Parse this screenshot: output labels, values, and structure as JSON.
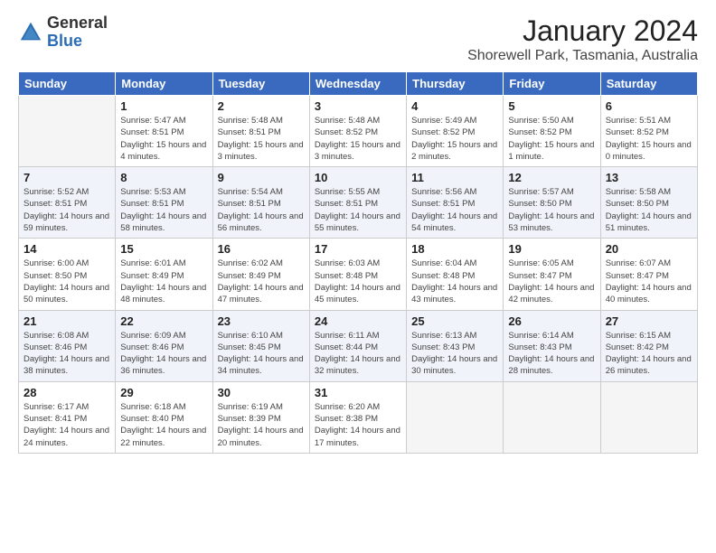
{
  "header": {
    "logo_general": "General",
    "logo_blue": "Blue",
    "title": "January 2024",
    "subtitle": "Shorewell Park, Tasmania, Australia"
  },
  "days_of_week": [
    "Sunday",
    "Monday",
    "Tuesday",
    "Wednesday",
    "Thursday",
    "Friday",
    "Saturday"
  ],
  "weeks": [
    [
      {
        "day": "",
        "sunrise": "",
        "sunset": "",
        "daylight": ""
      },
      {
        "day": "1",
        "sunrise": "Sunrise: 5:47 AM",
        "sunset": "Sunset: 8:51 PM",
        "daylight": "Daylight: 15 hours and 4 minutes."
      },
      {
        "day": "2",
        "sunrise": "Sunrise: 5:48 AM",
        "sunset": "Sunset: 8:51 PM",
        "daylight": "Daylight: 15 hours and 3 minutes."
      },
      {
        "day": "3",
        "sunrise": "Sunrise: 5:48 AM",
        "sunset": "Sunset: 8:52 PM",
        "daylight": "Daylight: 15 hours and 3 minutes."
      },
      {
        "day": "4",
        "sunrise": "Sunrise: 5:49 AM",
        "sunset": "Sunset: 8:52 PM",
        "daylight": "Daylight: 15 hours and 2 minutes."
      },
      {
        "day": "5",
        "sunrise": "Sunrise: 5:50 AM",
        "sunset": "Sunset: 8:52 PM",
        "daylight": "Daylight: 15 hours and 1 minute."
      },
      {
        "day": "6",
        "sunrise": "Sunrise: 5:51 AM",
        "sunset": "Sunset: 8:52 PM",
        "daylight": "Daylight: 15 hours and 0 minutes."
      }
    ],
    [
      {
        "day": "7",
        "sunrise": "Sunrise: 5:52 AM",
        "sunset": "Sunset: 8:51 PM",
        "daylight": "Daylight: 14 hours and 59 minutes."
      },
      {
        "day": "8",
        "sunrise": "Sunrise: 5:53 AM",
        "sunset": "Sunset: 8:51 PM",
        "daylight": "Daylight: 14 hours and 58 minutes."
      },
      {
        "day": "9",
        "sunrise": "Sunrise: 5:54 AM",
        "sunset": "Sunset: 8:51 PM",
        "daylight": "Daylight: 14 hours and 56 minutes."
      },
      {
        "day": "10",
        "sunrise": "Sunrise: 5:55 AM",
        "sunset": "Sunset: 8:51 PM",
        "daylight": "Daylight: 14 hours and 55 minutes."
      },
      {
        "day": "11",
        "sunrise": "Sunrise: 5:56 AM",
        "sunset": "Sunset: 8:51 PM",
        "daylight": "Daylight: 14 hours and 54 minutes."
      },
      {
        "day": "12",
        "sunrise": "Sunrise: 5:57 AM",
        "sunset": "Sunset: 8:50 PM",
        "daylight": "Daylight: 14 hours and 53 minutes."
      },
      {
        "day": "13",
        "sunrise": "Sunrise: 5:58 AM",
        "sunset": "Sunset: 8:50 PM",
        "daylight": "Daylight: 14 hours and 51 minutes."
      }
    ],
    [
      {
        "day": "14",
        "sunrise": "Sunrise: 6:00 AM",
        "sunset": "Sunset: 8:50 PM",
        "daylight": "Daylight: 14 hours and 50 minutes."
      },
      {
        "day": "15",
        "sunrise": "Sunrise: 6:01 AM",
        "sunset": "Sunset: 8:49 PM",
        "daylight": "Daylight: 14 hours and 48 minutes."
      },
      {
        "day": "16",
        "sunrise": "Sunrise: 6:02 AM",
        "sunset": "Sunset: 8:49 PM",
        "daylight": "Daylight: 14 hours and 47 minutes."
      },
      {
        "day": "17",
        "sunrise": "Sunrise: 6:03 AM",
        "sunset": "Sunset: 8:48 PM",
        "daylight": "Daylight: 14 hours and 45 minutes."
      },
      {
        "day": "18",
        "sunrise": "Sunrise: 6:04 AM",
        "sunset": "Sunset: 8:48 PM",
        "daylight": "Daylight: 14 hours and 43 minutes."
      },
      {
        "day": "19",
        "sunrise": "Sunrise: 6:05 AM",
        "sunset": "Sunset: 8:47 PM",
        "daylight": "Daylight: 14 hours and 42 minutes."
      },
      {
        "day": "20",
        "sunrise": "Sunrise: 6:07 AM",
        "sunset": "Sunset: 8:47 PM",
        "daylight": "Daylight: 14 hours and 40 minutes."
      }
    ],
    [
      {
        "day": "21",
        "sunrise": "Sunrise: 6:08 AM",
        "sunset": "Sunset: 8:46 PM",
        "daylight": "Daylight: 14 hours and 38 minutes."
      },
      {
        "day": "22",
        "sunrise": "Sunrise: 6:09 AM",
        "sunset": "Sunset: 8:46 PM",
        "daylight": "Daylight: 14 hours and 36 minutes."
      },
      {
        "day": "23",
        "sunrise": "Sunrise: 6:10 AM",
        "sunset": "Sunset: 8:45 PM",
        "daylight": "Daylight: 14 hours and 34 minutes."
      },
      {
        "day": "24",
        "sunrise": "Sunrise: 6:11 AM",
        "sunset": "Sunset: 8:44 PM",
        "daylight": "Daylight: 14 hours and 32 minutes."
      },
      {
        "day": "25",
        "sunrise": "Sunrise: 6:13 AM",
        "sunset": "Sunset: 8:43 PM",
        "daylight": "Daylight: 14 hours and 30 minutes."
      },
      {
        "day": "26",
        "sunrise": "Sunrise: 6:14 AM",
        "sunset": "Sunset: 8:43 PM",
        "daylight": "Daylight: 14 hours and 28 minutes."
      },
      {
        "day": "27",
        "sunrise": "Sunrise: 6:15 AM",
        "sunset": "Sunset: 8:42 PM",
        "daylight": "Daylight: 14 hours and 26 minutes."
      }
    ],
    [
      {
        "day": "28",
        "sunrise": "Sunrise: 6:17 AM",
        "sunset": "Sunset: 8:41 PM",
        "daylight": "Daylight: 14 hours and 24 minutes."
      },
      {
        "day": "29",
        "sunrise": "Sunrise: 6:18 AM",
        "sunset": "Sunset: 8:40 PM",
        "daylight": "Daylight: 14 hours and 22 minutes."
      },
      {
        "day": "30",
        "sunrise": "Sunrise: 6:19 AM",
        "sunset": "Sunset: 8:39 PM",
        "daylight": "Daylight: 14 hours and 20 minutes."
      },
      {
        "day": "31",
        "sunrise": "Sunrise: 6:20 AM",
        "sunset": "Sunset: 8:38 PM",
        "daylight": "Daylight: 14 hours and 17 minutes."
      },
      {
        "day": "",
        "sunrise": "",
        "sunset": "",
        "daylight": ""
      },
      {
        "day": "",
        "sunrise": "",
        "sunset": "",
        "daylight": ""
      },
      {
        "day": "",
        "sunrise": "",
        "sunset": "",
        "daylight": ""
      }
    ]
  ]
}
